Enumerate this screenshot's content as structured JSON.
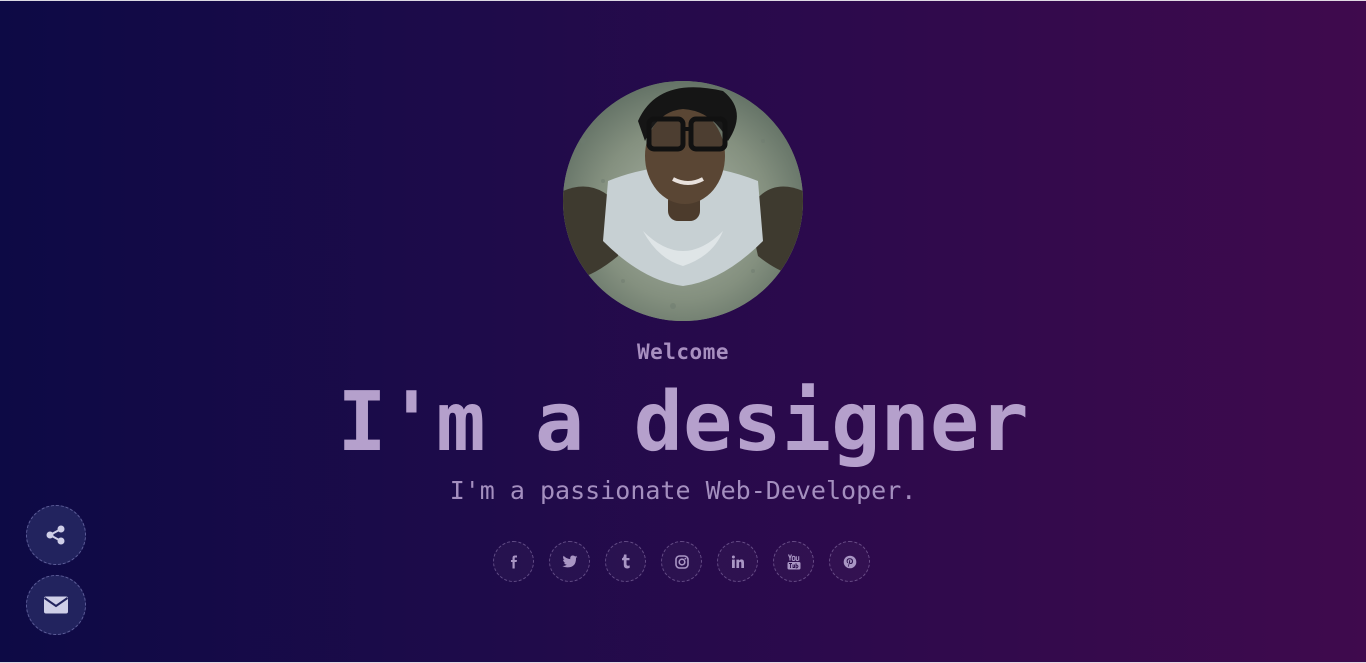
{
  "hero": {
    "greeting": "Welcome",
    "headline": "I'm a designer",
    "tagline": "I'm a passionate Web-Developer."
  },
  "avatar": {
    "icon": "profile-photo"
  },
  "social_links": [
    {
      "name": "facebook",
      "icon": "facebook-icon"
    },
    {
      "name": "twitter",
      "icon": "twitter-icon"
    },
    {
      "name": "tumblr",
      "icon": "tumblr-icon"
    },
    {
      "name": "instagram",
      "icon": "instagram-icon"
    },
    {
      "name": "linkedin",
      "icon": "linkedin-icon"
    },
    {
      "name": "youtube",
      "icon": "youtube-icon"
    },
    {
      "name": "pinterest",
      "icon": "pinterest-icon"
    }
  ],
  "floating_actions": [
    {
      "name": "share",
      "icon": "share-icon"
    },
    {
      "name": "mail",
      "icon": "envelope-icon"
    }
  ],
  "colors": {
    "background_left": "#0d0a45",
    "background_right": "#3f0a4d",
    "text": "#b5a0cc",
    "fab_background": "#22235e"
  }
}
